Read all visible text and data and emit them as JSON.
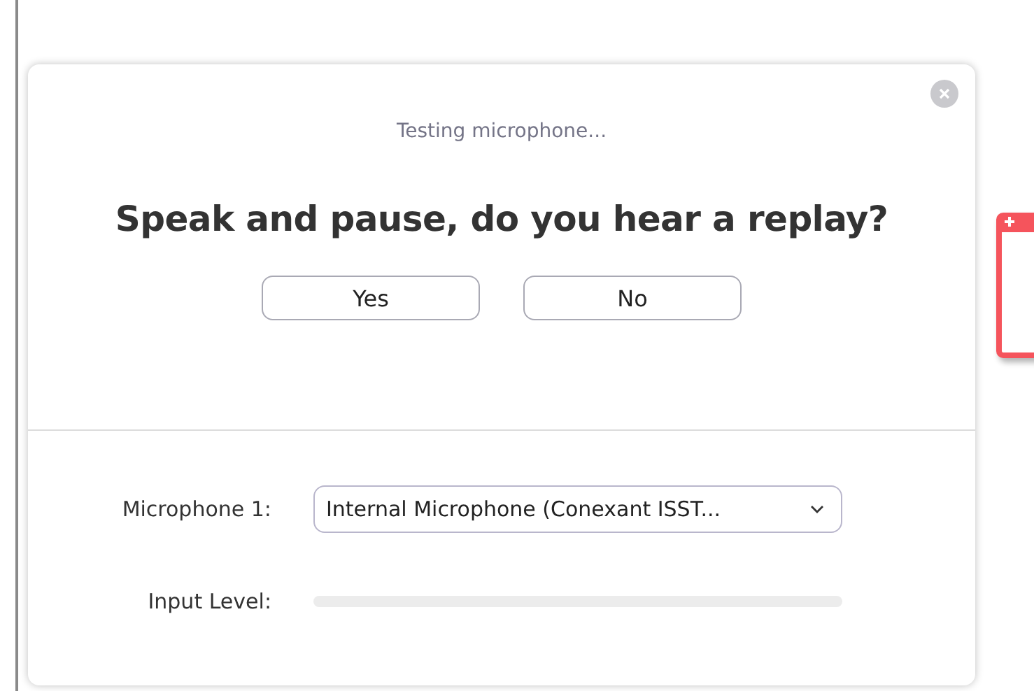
{
  "dialog": {
    "status": "Testing microphone...",
    "question": "Speak and pause, do you hear a replay?",
    "buttons": [
      "Yes",
      "No"
    ],
    "microphone": {
      "label": "Microphone 1:",
      "value": "Internal Microphone (Conexant ISST..."
    },
    "input_level": {
      "label": "Input Level:",
      "level": 0
    }
  }
}
